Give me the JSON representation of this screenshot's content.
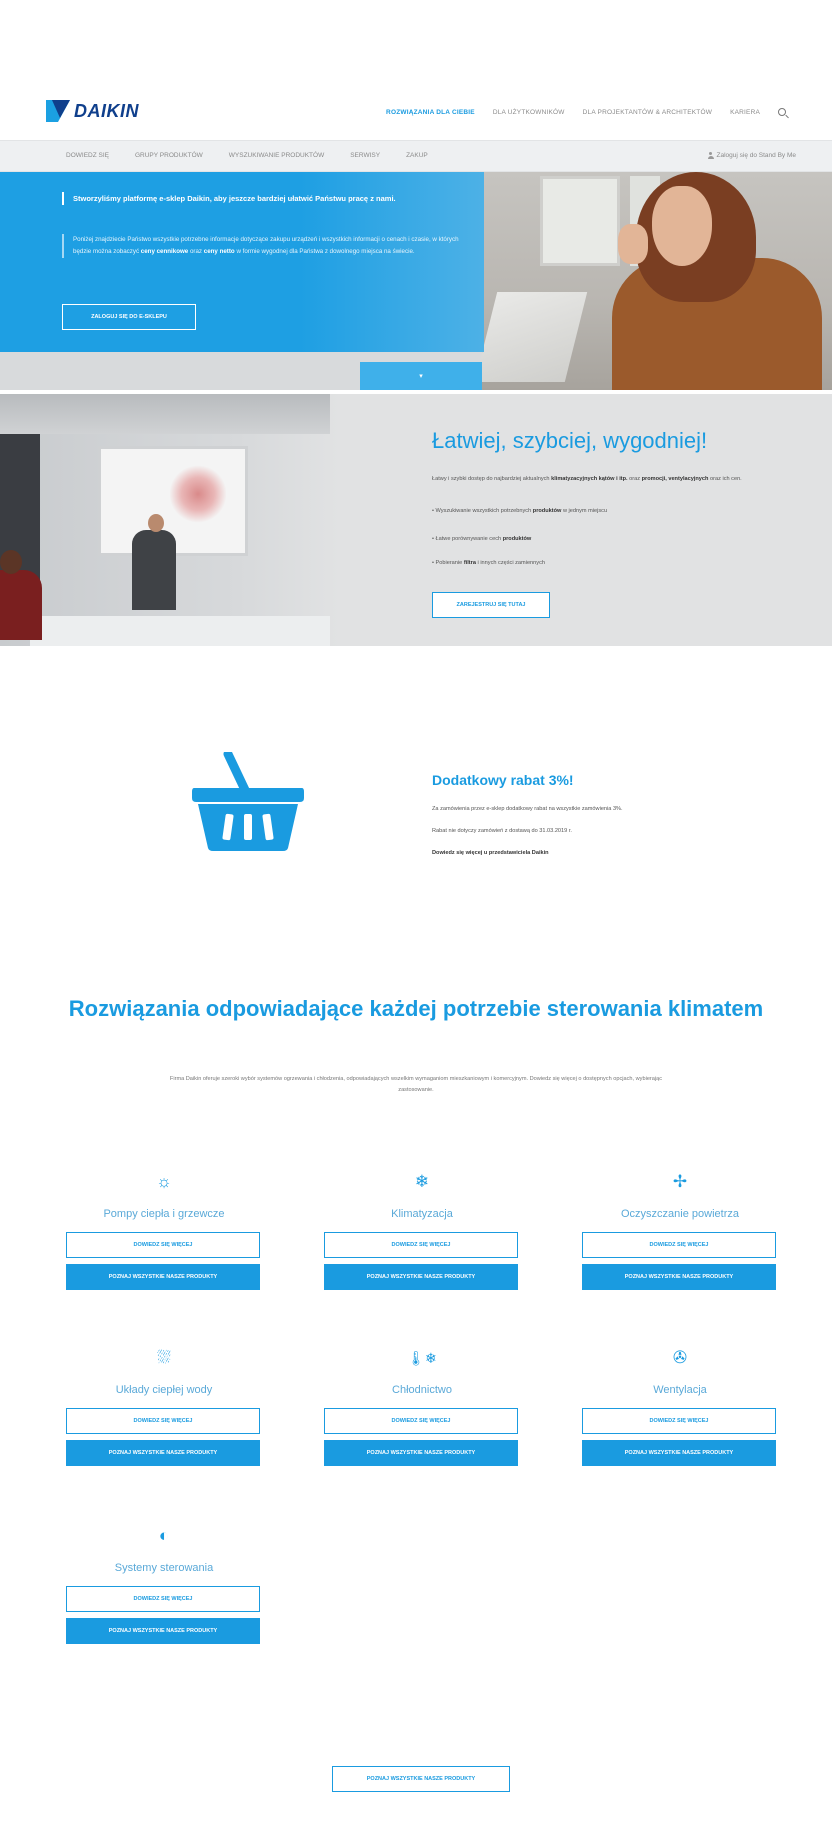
{
  "brand": {
    "name": "DAIKIN",
    "primary_color": "#1a9be0",
    "logo_color": "#0f3f8c"
  },
  "topnav": {
    "items": [
      "ROZWIĄZANIA DLA CIEBIE",
      "DLA UŻYTKOWNIKÓW",
      "DLA PROJEKTANTÓW & ARCHITEKTÓW",
      "KARIERA"
    ]
  },
  "subnav": {
    "items": [
      "DOWIEDZ SIĘ",
      "GRUPY PRODUKTÓW",
      "WYSZUKIWANIE PRODUKTÓW",
      "SERWISY",
      "ZAKUP"
    ],
    "account": "Zaloguj się do Stand By Me"
  },
  "hero": {
    "title": "Stworzyliśmy platformę e-sklep Daikin, aby jeszcze bardziej ułatwić Państwu pracę z nami.",
    "text_before": "Poniżej znajdziecie Państwo wszystkie potrzebne informacje dotyczące zakupu urządzeń i wszystkich informacji o cenach i czasie, w których będzie można zobaczyć",
    "text_bold1": "ceny cennikowe",
    "text_mid": "oraz",
    "text_bold2": "ceny netto",
    "text_after": "w formie wygodnej dla Państwa z dowolnego miejsca na świecie.",
    "button": "ZALOGUJ SIĘ DO E-SKLEPU",
    "tab_arrow": "▾"
  },
  "promo": {
    "title": "Łatwiej, szybciej, wygodniej!",
    "intro_before": "Łatwy i szybki dostęp do najbardziej aktualnych",
    "intro_bold1": "klimatyzacyjnych kątów i itp.",
    "intro_mid": "oraz",
    "intro_bold2": "promocji, ventylacyjnych",
    "intro_after": "oraz ich cen.",
    "bullets": [
      {
        "before": "• Wyszukiwanie wszystkich potrzebnych",
        "bold": "produktów",
        "after": "w jednym miejscu"
      },
      {
        "before": "• Łatwe porównywanie cech",
        "bold": "produktów",
        "after": ""
      },
      {
        "before": "• Pobieranie",
        "bold": "filtra",
        "after": "i innych części zamiennych"
      }
    ],
    "button": "ZAREJESTRUJ SIĘ TUTAJ"
  },
  "rabat": {
    "title": "Dodatkowy rabat 3%!",
    "line1": "Za zamówienia przez e-sklep dodatkowy rabat na wszystkie zamówienia 3%.",
    "line2": "Rabat nie dotyczy zamówień z dostawą do 31.03.2019 r.",
    "line3": "Dowiedz się więcej u przedstawiciela Daikin",
    "icon": "basket-icon"
  },
  "solutions": {
    "title": "Rozwiązania odpowiadające każdej potrzebie sterowania klimatem",
    "description": "Firma Daikin oferuje szeroki wybór systemów ogrzewania i chłodzenia, odpowiadających wszelkim wymaganiom mieszkaniowym i komercyjnym. Dowiedz się więcej o dostępnych opcjach, wybierając zastosowanie.",
    "learn_more": "DOWIEDZ SIĘ WIĘCEJ",
    "all_products": "POZNAJ WSZYSTKIE NASZE PRODUKTY",
    "cards": [
      {
        "label": "Pompy ciepła i grzewcze",
        "icon": "sun-icon",
        "glyph": "☼"
      },
      {
        "label": "Klimatyzacja",
        "icon": "snowflake-icon",
        "glyph": "❄"
      },
      {
        "label": "Oczyszczanie powietrza",
        "icon": "air-purifier-icon",
        "glyph": "✢"
      },
      {
        "label": "Układy ciepłej wody",
        "icon": "shower-icon",
        "glyph": "⛆"
      },
      {
        "label": "Chłodnictwo",
        "icon": "thermometer-snowflake-icon",
        "glyph": "🌡❄"
      },
      {
        "label": "Wentylacja",
        "icon": "fan-icon",
        "glyph": "✇"
      },
      {
        "label": "Systemy sterowania",
        "icon": "control-icon",
        "glyph": "◐"
      }
    ]
  },
  "footer_button": "POZNAJ WSZYSTKIE NASZE PRODUKTY"
}
